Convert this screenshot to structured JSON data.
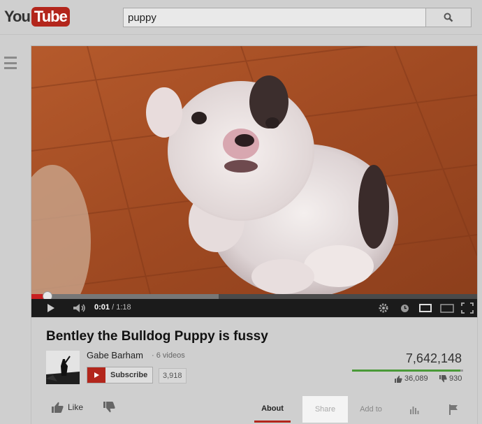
{
  "logo": {
    "you": "You",
    "tube": "Tube"
  },
  "search": {
    "query": "puppy"
  },
  "player": {
    "current_time": "0:01",
    "duration": "/ 1:18",
    "played_fraction": 0.035,
    "buffered_fraction": 0.42
  },
  "video": {
    "title": "Bentley the Bulldog Puppy is fussy",
    "channel": "Gabe Barham",
    "video_count": "· 6 videos",
    "subscribe_label": "Subscribe",
    "subscriber_count": "3,918",
    "views": "7,642,148",
    "likes": "36,089",
    "dislikes": "930",
    "like_fraction": 0.975
  },
  "actions": {
    "like_label": "Like",
    "tabs": [
      "About",
      "Share",
      "Add to"
    ]
  },
  "colors": {
    "brand_red": "#b3261c",
    "like_green": "#4a9a38"
  }
}
